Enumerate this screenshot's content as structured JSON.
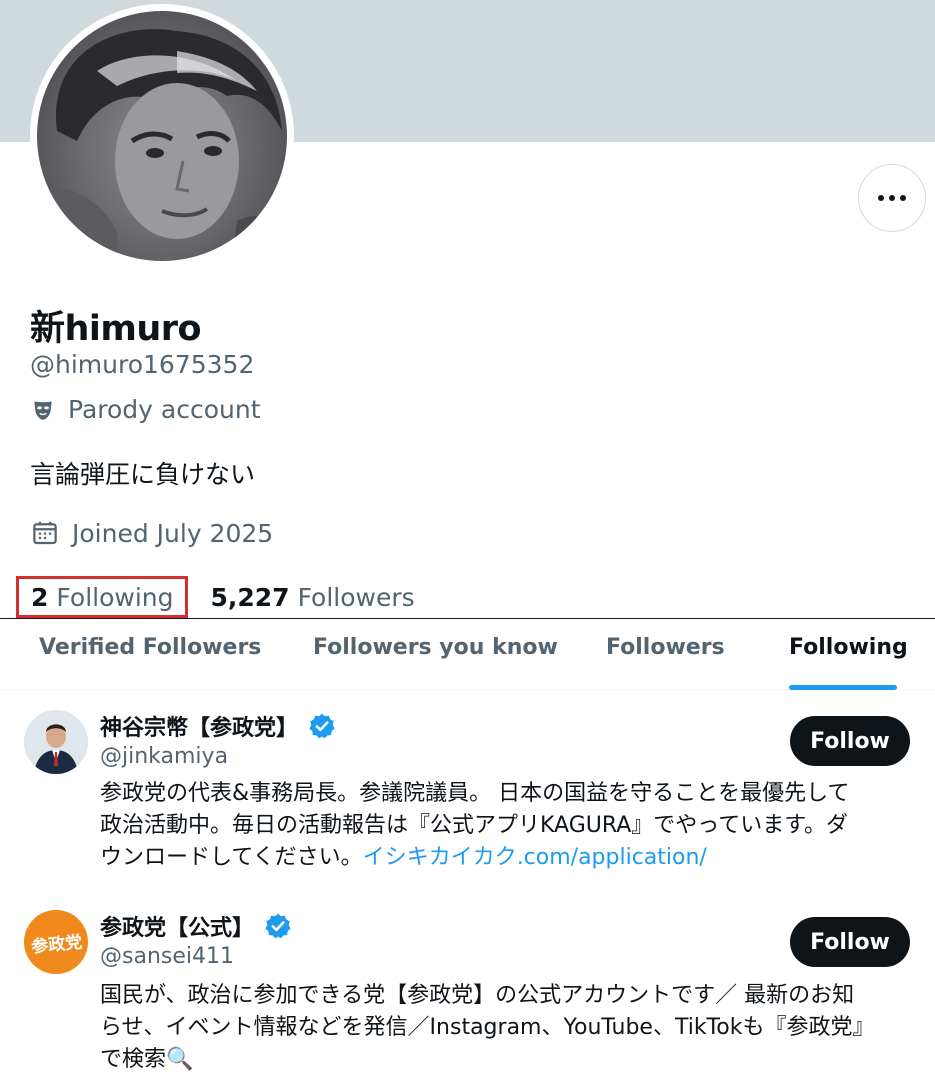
{
  "profile": {
    "display_name": "新himuro",
    "handle": "@himuro1675352",
    "account_label": "Parody account",
    "account_label_icon": "parody-mask-icon",
    "bio": "言論弾圧に負けない",
    "joined": "Joined July 2025",
    "following_count": "2",
    "following_label": "Following",
    "followers_count": "5,227",
    "followers_label": "Followers"
  },
  "colors": {
    "banner": "#cfd9de",
    "accent": "#1d9bf0",
    "highlight_box": "#d32f2f",
    "text_primary": "#0f1419",
    "text_secondary": "#536471"
  },
  "tabs": [
    {
      "label": "Verified Followers",
      "active": false
    },
    {
      "label": "Followers you know",
      "active": false
    },
    {
      "label": "Followers",
      "active": false
    },
    {
      "label": "Following",
      "active": true
    }
  ],
  "users": [
    {
      "name": "神谷宗幣【参政党】",
      "verified": true,
      "handle": "@jinkamiya",
      "follow_label": "Follow",
      "bio_line1": "参政党の代表&事務局長。参議院議員。 日本の国益を守ることを最優先して",
      "bio_line2": "政治活動中。毎日の活動報告は『公式アプリKAGURA』でやっています。ダ",
      "bio_line3_text": "ウンロードしてください。",
      "bio_line3_link": "イシキカイカク.com/application/"
    },
    {
      "name": "参政党【公式】",
      "verified": true,
      "handle": "@sansei411",
      "follow_label": "Follow",
      "avatar_text": "参政党",
      "bio_line1": "国民が、政治に参加できる党【参政党】の公式アカウントです／ 最新のお知",
      "bio_line2": "らせ、イベント情報などを発信／Instagram、YouTube、TikTokも『参政党』",
      "bio_line3_text": "で検索🔍"
    }
  ]
}
